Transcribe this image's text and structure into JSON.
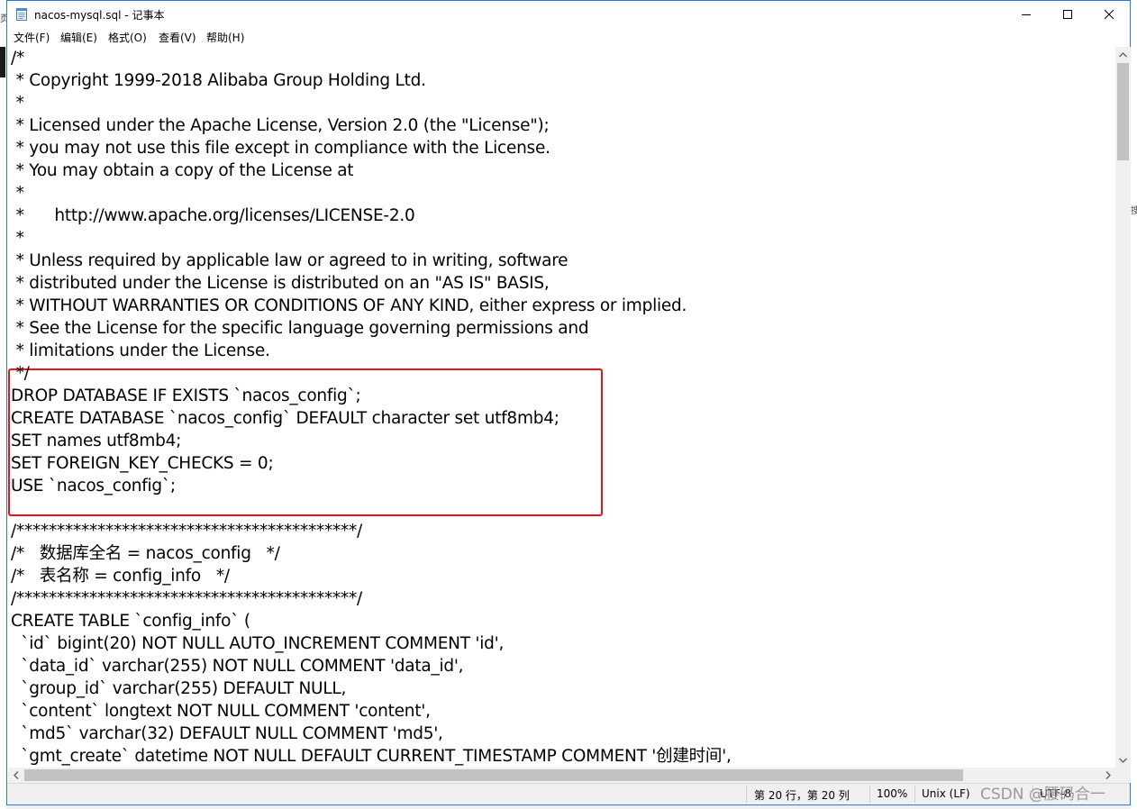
{
  "window": {
    "title": "nacos-mysql.sql - 记事本"
  },
  "menu": [
    {
      "label": "文件(F)"
    },
    {
      "label": "编辑(E)"
    },
    {
      "label": "格式(O)"
    },
    {
      "label": "查看(V)"
    },
    {
      "label": "帮助(H)"
    }
  ],
  "editor": {
    "lines": [
      "/*",
      " * Copyright 1999-2018 Alibaba Group Holding Ltd.",
      " *",
      " * Licensed under the Apache License, Version 2.0 (the \"License\");",
      " * you may not use this file except in compliance with the License.",
      " * You may obtain a copy of the License at",
      " *",
      " *      http://www.apache.org/licenses/LICENSE-2.0",
      " *",
      " * Unless required by applicable law or agreed to in writing, software",
      " * distributed under the License is distributed on an \"AS IS\" BASIS,",
      " * WITHOUT WARRANTIES OR CONDITIONS OF ANY KIND, either express or implied.",
      " * See the License for the specific language governing permissions and",
      " * limitations under the License.",
      " */",
      "DROP DATABASE IF EXISTS `nacos_config`;",
      "CREATE DATABASE `nacos_config` DEFAULT character set utf8mb4;",
      "SET names utf8mb4;",
      "SET FOREIGN_KEY_CHECKS = 0;",
      "USE `nacos_config`;",
      "",
      "/******************************************/",
      "/*   数据库全名 = nacos_config   */",
      "/*   表名称 = config_info   */",
      "/******************************************/",
      "CREATE TABLE `config_info` (",
      "  `id` bigint(20) NOT NULL AUTO_INCREMENT COMMENT 'id',",
      "  `data_id` varchar(255) NOT NULL COMMENT 'data_id',",
      "  `group_id` varchar(255) DEFAULT NULL,",
      "  `content` longtext NOT NULL COMMENT 'content',",
      "  `md5` varchar(32) DEFAULT NULL COMMENT 'md5',",
      "  `gmt_create` datetime NOT NULL DEFAULT CURRENT_TIMESTAMP COMMENT '创建时间',"
    ]
  },
  "statusbar": {
    "position": "第 20 行，第 20 列",
    "zoom": "100%",
    "line_ending": "Unix (LF)",
    "encoding": "UTF-8"
  },
  "watermark": "CSDN @腰码合一",
  "edge": {
    "left_glyph": "页",
    "right_glyph": "搜"
  },
  "colors": {
    "highlight_border": "#e8161b",
    "window_border": "#2b79d8",
    "scrollbar_thumb": "#c2c2c2"
  }
}
